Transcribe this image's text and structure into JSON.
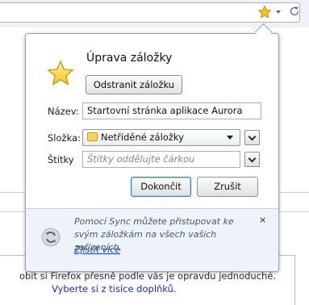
{
  "toolbar": {
    "bookmark_star_icon": "star-icon",
    "dropdown_icon": "chevron-down-icon",
    "refresh_icon": "refresh-icon"
  },
  "panel": {
    "title": "Úprava záložky",
    "remove_button": "Odstranit záložku",
    "name_label": "Název:",
    "name_value": "Startovní stránka aplikace Aurora",
    "folder_label": "Složka:",
    "folder_value": "Netříděné záložky",
    "tags_label": "Štítky",
    "tags_placeholder": "Štítky oddělujte čárkou",
    "done_button": "Dokončit",
    "cancel_button": "Zrušit"
  },
  "sync": {
    "message": "Pomocí Sync můžete přistupovat ke svým záložkám na všech vašich zařízeních.",
    "link": "Zjistit více",
    "close": "×"
  },
  "background": {
    "line1": "obit si Firefox přesně podle vás je opravdu jednoduché.",
    "line2": "Vyberte si z tisíce doplňků."
  },
  "colors": {
    "star": "#f2c51e",
    "link": "#1e3fbf",
    "sync_bg": "#eef3f9"
  }
}
